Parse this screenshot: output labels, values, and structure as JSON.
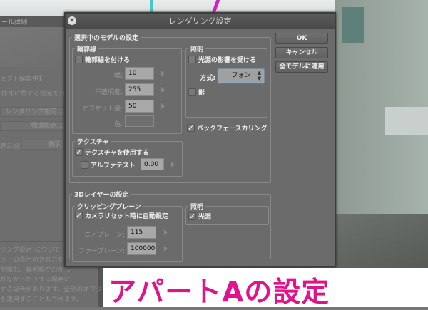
{
  "left_panel": {
    "title": "ール詳細",
    "status": "ェクト編集中】",
    "desc": "操作に関する設定を行い",
    "rendering_btn": "レンダリング設定...",
    "physics_btn": "物理設定...",
    "display_label": "表示設定",
    "display_btn": "表示",
    "help_title": "リング設定]について",
    "help_lines": [
      "ットの表示のされ方を設定",
      "や陰影、輪郭線がおかし",
      "れなかったりする場合に",
      "する場合があります。全部のオブジ",
      "を適用することもできます。"
    ]
  },
  "dialog": {
    "title": "レンダリング設定",
    "model_group": "選択中のモデルの設定",
    "outline": {
      "group": "輪郭線",
      "enable": "輪郭線を付ける",
      "enabled": false,
      "width_label": "幅:",
      "width": "10",
      "opacity_label": "不透明度:",
      "opacity": "255",
      "offset_label": "オフセット量:",
      "offset": "50",
      "color_label": "色:"
    },
    "lighting": {
      "group": "照明",
      "receive": "光源の影響を受ける",
      "receive_checked": false,
      "method_label": "方式:",
      "method": "フォン",
      "shadow": "影",
      "shadow_checked": false
    },
    "backface": {
      "label": "バックフェースカリング",
      "checked": true
    },
    "texture": {
      "group": "テクスチャ",
      "use": "テクスチャを使用する",
      "use_checked": true,
      "alpha": "アルファテスト",
      "alpha_checked": false,
      "alpha_value": "0.00"
    },
    "layer_group": "3Dレイヤーの設定",
    "clipping": {
      "group": "クリッピングプレーン",
      "auto": "カメラリセット時に自動設定",
      "auto_checked": true,
      "near_label": "ニアプレーン:",
      "near": "115",
      "far_label": "ファープレーン:",
      "far": "100000"
    },
    "layer_lighting": {
      "group": "照明",
      "light": "光源",
      "light_checked": true
    },
    "buttons": {
      "ok": "OK",
      "cancel": "キャンセル",
      "apply_all": "全モデルに適用"
    }
  },
  "caption": "アパートAの設定"
}
